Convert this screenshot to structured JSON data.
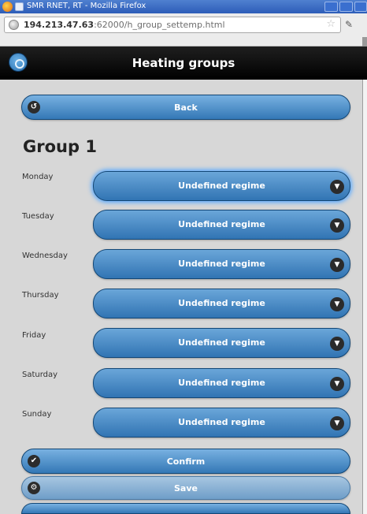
{
  "window": {
    "title": "SMR RNET, RT - Mozilla Firefox",
    "url_host": "194.213.47.63",
    "url_rest": ":62000/h_group_settemp.html"
  },
  "header": {
    "title": "Heating groups"
  },
  "back_label": "Back",
  "group_title": "Group 1",
  "days": [
    {
      "label": "Monday",
      "value": "Undefined regime"
    },
    {
      "label": "Tuesday",
      "value": "Undefined regime"
    },
    {
      "label": "Wednesday",
      "value": "Undefined regime"
    },
    {
      "label": "Thursday",
      "value": "Undefined regime"
    },
    {
      "label": "Friday",
      "value": "Undefined regime"
    },
    {
      "label": "Saturday",
      "value": "Undefined regime"
    },
    {
      "label": "Sunday",
      "value": "Undefined regime"
    }
  ],
  "actions": {
    "confirm_label": "Confirm",
    "save_label": "Save"
  }
}
